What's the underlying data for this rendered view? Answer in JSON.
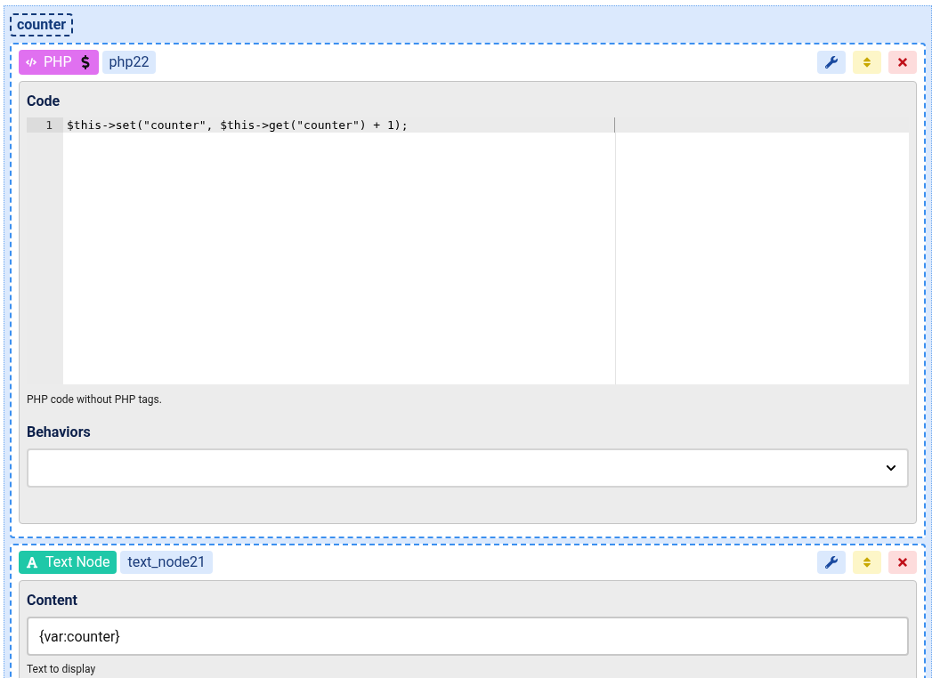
{
  "group": {
    "label": "counter"
  },
  "nodes": [
    {
      "kind": "php",
      "type_label": "PHP",
      "id_label": "php22",
      "fields": [
        {
          "kind": "code",
          "label": "Code",
          "lines": [
            {
              "number": "1",
              "text": "$this->set(\"counter\", $this->get(\"counter\") + 1);"
            }
          ],
          "help": "PHP code without PHP tags."
        },
        {
          "kind": "select",
          "label": "Behaviors"
        }
      ]
    },
    {
      "kind": "text",
      "type_label": "Text Node",
      "id_label": "text_node21",
      "fields": [
        {
          "kind": "input",
          "label": "Content",
          "value": "{var:counter}",
          "help": "Text to display"
        }
      ]
    }
  ]
}
